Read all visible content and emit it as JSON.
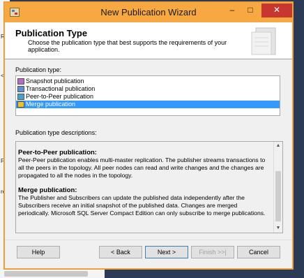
{
  "window": {
    "title": "New Publication Wizard",
    "controls": {
      "minimize": "–",
      "maximize": "□",
      "close": "✕"
    }
  },
  "header": {
    "title": "Publication Type",
    "description": "Choose the publication type that best supports the requirements of your application."
  },
  "publication_types": {
    "label": "Publication type:",
    "items": [
      {
        "label": "Snapshot publication",
        "icon": "snapshot-icon"
      },
      {
        "label": "Transactional publication",
        "icon": "transactional-icon"
      },
      {
        "label": "Peer-to-Peer publication",
        "icon": "peer-icon"
      },
      {
        "label": "Merge publication",
        "icon": "merge-icon",
        "selected": true
      }
    ]
  },
  "descriptions": {
    "label": "Publication type descriptions:",
    "sections": [
      {
        "heading": "Peer-to-Peer publication:",
        "text": "Peer-Peer publication enables multi-master replication. The publisher streams transactions to all the peers in the topology. All peer nodes can read and write changes and the changes are propagated to all the nodes in the topology."
      },
      {
        "heading": "Merge publication:",
        "text": "The Publisher and Subscribers can update the published data independently after the Subscribers receive an initial snapshot of the published data. Changes are merged periodically. Microsoft SQL Server Compact Edition can only subscribe to merge publications."
      }
    ]
  },
  "buttons": {
    "help": "Help",
    "back": "< Back",
    "next": "Next >",
    "finish": "Finish >>|",
    "cancel": "Cancel"
  },
  "background": {
    "left_chars": [
      "R",
      "<",
      "F",
      "re"
    ]
  },
  "colors": {
    "titlebar": "#f7a840",
    "selection": "#3399ff",
    "close_button": "#c7372f"
  }
}
